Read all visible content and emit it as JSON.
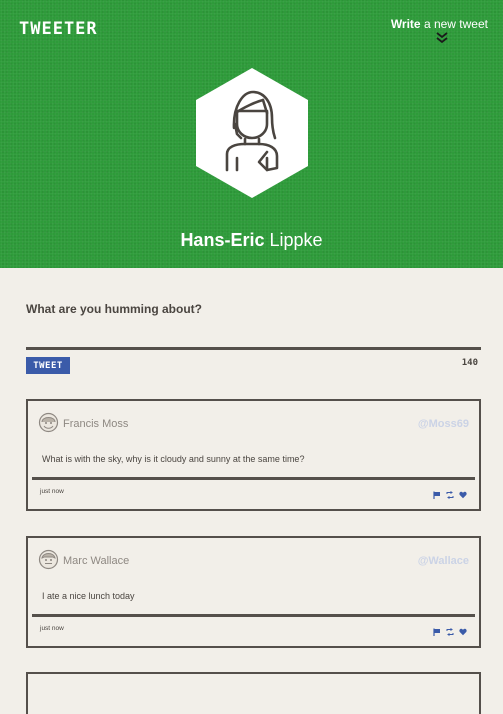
{
  "app": {
    "logo": "TWEETER"
  },
  "header": {
    "write_bold": "Write",
    "write_rest": "a new tweet",
    "user_first": "Hans-Eric",
    "user_last": "Lippke"
  },
  "compose": {
    "prompt": "What are you humming about?",
    "button_label": "TWEET",
    "char_count": "140"
  },
  "feed": [
    {
      "name": "Francis Moss",
      "handle": "@Moss69",
      "text": "What is with the sky, why is it cloudy and sunny at the same time?",
      "time": "just now"
    },
    {
      "name": "Marc Wallace",
      "handle": "@Wallace",
      "text": "I ate a nice lunch today",
      "time": "just now"
    }
  ],
  "colors": {
    "header_green": "#2e9b3a",
    "tweet_button": "#3b5ba9",
    "background": "#f2efe9",
    "border": "#55504b",
    "handle": "#cbd3e6"
  }
}
